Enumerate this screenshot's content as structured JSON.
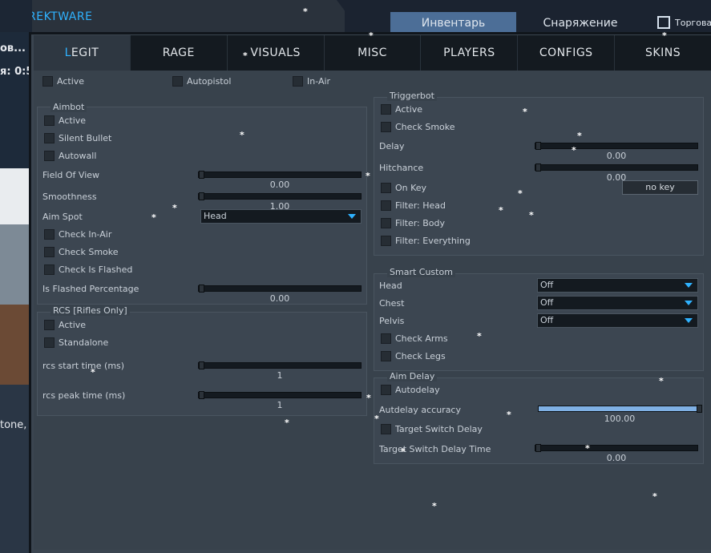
{
  "window": {
    "title": "REKTWARE"
  },
  "background": {
    "top_tabs": [
      {
        "label": "Инвентарь",
        "active": true
      },
      {
        "label": "Снаряжение",
        "active": false
      },
      {
        "label": "Торгова",
        "active": false
      }
    ],
    "left_fragments": [
      "ов...",
      "я: 0:5",
      "tone,"
    ]
  },
  "tabs": [
    {
      "first": "L",
      "rest": "EGIT",
      "active": true
    },
    {
      "label": "RAGE"
    },
    {
      "label": "VISUALS"
    },
    {
      "label": "MISC"
    },
    {
      "label": "PLAYERS"
    },
    {
      "label": "CONFIGS"
    },
    {
      "label": "SKINS"
    }
  ],
  "top_checks": [
    "Active",
    "Autopistol",
    "In-Air"
  ],
  "aimbot": {
    "title": "Aimbot",
    "checks": [
      "Active",
      "Silent Bullet",
      "Autowall"
    ],
    "fov_label": "Field Of View",
    "fov_value": "0.00",
    "smooth_label": "Smoothness",
    "smooth_value": "1.00",
    "aimspot_label": "Aim Spot",
    "aimspot_value": "Head",
    "checks2": [
      "Check In-Air",
      "Check Smoke",
      "Check Is Flashed"
    ],
    "flashed_label": "Is Flashed Percentage",
    "flashed_value": "0.00"
  },
  "rcs": {
    "title": "RCS [Rifles Only]",
    "checks": [
      "Active",
      "Standalone"
    ],
    "start_label": "rcs start time (ms)",
    "start_value": "1",
    "peak_label": "rcs peak time (ms)",
    "peak_value": "1"
  },
  "triggerbot": {
    "title": "Triggerbot",
    "checks": [
      "Active",
      "Check Smoke"
    ],
    "delay_label": "Delay",
    "delay_value": "0.00",
    "hitchance_label": "Hitchance",
    "hitchance_value": "0.00",
    "onkey_label": "On Key",
    "key_button": "no key",
    "filters": [
      "Filter: Head",
      "Filter: Body",
      "Filter: Everything"
    ]
  },
  "smart_custom": {
    "title": "Smart Custom",
    "rows": [
      {
        "label": "Head",
        "value": "Off"
      },
      {
        "label": "Chest",
        "value": "Off"
      },
      {
        "label": "Pelvis",
        "value": "Off"
      }
    ],
    "checks": [
      "Check Arms",
      "Check Legs"
    ]
  },
  "aim_delay": {
    "title": "Aim Delay",
    "autodelay": "Autodelay",
    "accuracy_label": "Autdelay accuracy",
    "accuracy_value": "100.00",
    "accuracy_fill": 1.0,
    "target_switch": "Target Switch Delay",
    "switch_time_label": "Target Switch Delay Time",
    "switch_time_value": "0.00"
  }
}
